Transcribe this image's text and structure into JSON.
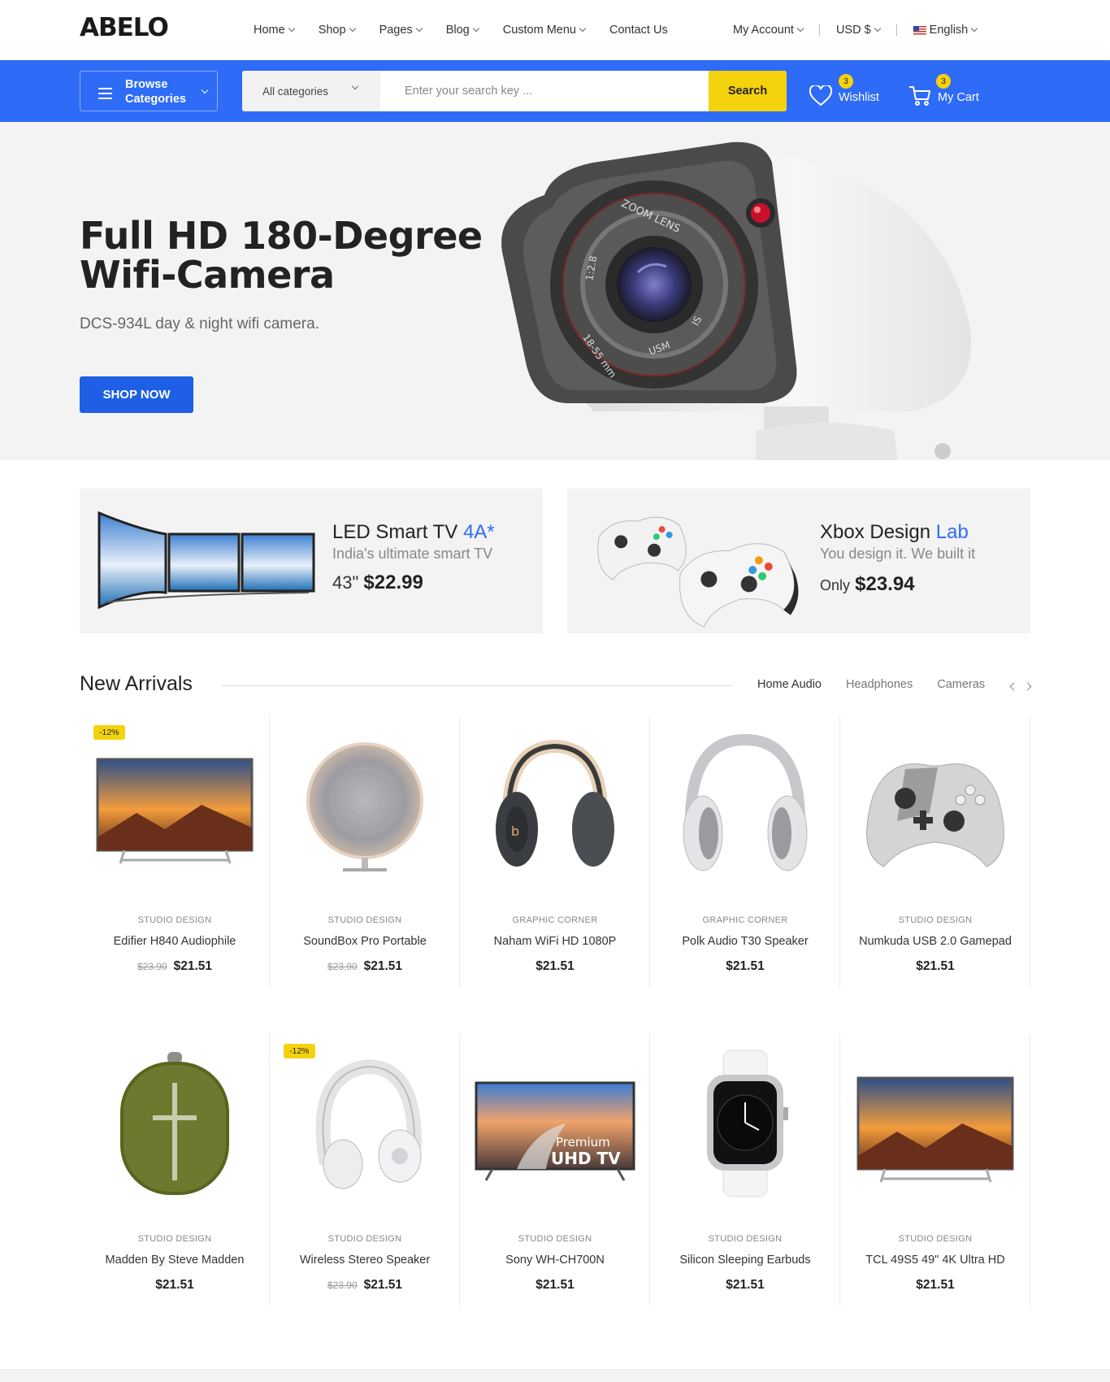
{
  "brand": {
    "logo": "ABELO"
  },
  "nav": [
    {
      "label": "Home",
      "has_dropdown": true
    },
    {
      "label": "Shop",
      "has_dropdown": true
    },
    {
      "label": "Pages",
      "has_dropdown": true
    },
    {
      "label": "Blog",
      "has_dropdown": true
    },
    {
      "label": "Custom Menu",
      "has_dropdown": true
    },
    {
      "label": "Contact Us",
      "has_dropdown": false
    }
  ],
  "utils": {
    "account": "My Account",
    "currency": "USD $",
    "language": "English"
  },
  "searchbar": {
    "browse_label": "Browse Categories",
    "category": "All categories",
    "placeholder": "Enter your search key ...",
    "button": "Search"
  },
  "wishlist": {
    "label": "Wishlist",
    "count": "3"
  },
  "cart": {
    "label": "My Cart",
    "count": "3"
  },
  "hero": {
    "title": "Full HD 180-Degree Wifi-Camera",
    "subtitle": "DCS-934L day & night wifi camera.",
    "button": "SHOP NOW",
    "lens_text": [
      "ZOOM LENS",
      "18-55 mm",
      "1:2.8",
      "USM",
      "IS"
    ]
  },
  "banners": [
    {
      "title": "LED Smart TV",
      "accent": "4A*",
      "subtitle": "India's ultimate smart TV",
      "price_prefix": "43\"",
      "price": "$22.99"
    },
    {
      "title": "Xbox Design",
      "accent": "Lab",
      "subtitle": "You design it. We built it",
      "price_prefix": "Only",
      "price": "$23.94"
    }
  ],
  "new_arrivals": {
    "title": "New Arrivals",
    "tabs": [
      "Home Audio",
      "Headphones",
      "Cameras"
    ],
    "products": [
      {
        "brand": "STUDIO DESIGN",
        "name": "Edifier H840 Audiophile",
        "old_price": "$23.90",
        "price": "$21.51",
        "discount": "-12%",
        "icon": "tv"
      },
      {
        "brand": "STUDIO DESIGN",
        "name": "SoundBox Pro Portable",
        "old_price": "$23.90",
        "price": "$21.51",
        "discount": "",
        "icon": "speaker"
      },
      {
        "brand": "GRAPHIC CORNER",
        "name": "Naham WiFi HD 1080P",
        "old_price": "",
        "price": "$21.51",
        "discount": "",
        "icon": "headphones-dark"
      },
      {
        "brand": "GRAPHIC CORNER",
        "name": "Polk Audio T30 Speaker",
        "old_price": "",
        "price": "$21.51",
        "discount": "",
        "icon": "headphones-silver"
      },
      {
        "brand": "STUDIO DESIGN",
        "name": "Numkuda USB 2.0 Gamepad",
        "old_price": "",
        "price": "$21.51",
        "discount": "",
        "icon": "gamepad"
      },
      {
        "brand": "STUDIO DESIGN",
        "name": "Madden By Steve Madden",
        "old_price": "",
        "price": "$21.51",
        "discount": "",
        "icon": "bt-speaker"
      },
      {
        "brand": "STUDIO DESIGN",
        "name": "Wireless Stereo Speaker",
        "old_price": "$23.90",
        "price": "$21.51",
        "discount": "-12%",
        "icon": "headphones-white"
      },
      {
        "brand": "STUDIO DESIGN",
        "name": "Sony WH-CH700N",
        "old_price": "",
        "price": "$21.51",
        "discount": "",
        "icon": "uhd-tv",
        "image_text": [
          "Premium",
          "UHD TV"
        ]
      },
      {
        "brand": "STUDIO DESIGN",
        "name": "Silicon Sleeping Earbuds",
        "old_price": "",
        "price": "$21.51",
        "discount": "",
        "icon": "smartwatch"
      },
      {
        "brand": "STUDIO DESIGN",
        "name": "TCL 49S5 49\" 4K Ultra HD",
        "old_price": "",
        "price": "$21.51",
        "discount": "",
        "icon": "tv"
      }
    ]
  },
  "colors": {
    "primary": "#2e6bf7",
    "accent_yellow": "#f5d20e",
    "button_blue": "#1f5fe6",
    "hero_bg": "#f3f3f3"
  }
}
